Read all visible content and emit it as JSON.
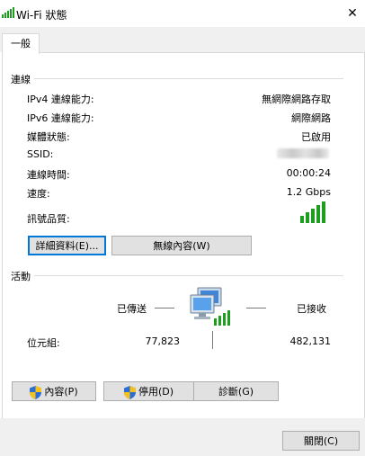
{
  "window": {
    "title": "Wi-Fi 狀態",
    "close_glyph": "✕"
  },
  "tabs": [
    {
      "label": "一般"
    }
  ],
  "connection": {
    "section_label": "連線",
    "rows": [
      {
        "label": "IPv4 連線能力:",
        "value": "無網際網路存取"
      },
      {
        "label": "IPv6 連線能力:",
        "value": "網際網路"
      },
      {
        "label": "媒體狀態:",
        "value": "已啟用"
      },
      {
        "label": "SSID:",
        "value": ""
      },
      {
        "label": "連線時間:",
        "value": "00:00:24"
      },
      {
        "label": "速度:",
        "value": "1.2 Gbps"
      }
    ],
    "signal_label": "訊號品質:",
    "signal_bars": 5,
    "details_button": "詳細資料(E)...",
    "wireless_props_button": "無線內容(W)"
  },
  "activity": {
    "section_label": "活動",
    "sent_label": "已傳送",
    "received_label": "已接收",
    "bytes_label": "位元組:",
    "bytes_sent": "77,823",
    "bytes_received": "482,131"
  },
  "action_buttons": {
    "properties": "內容(P)",
    "disable": "停用(D)",
    "diagnose": "診斷(G)"
  },
  "footer": {
    "close_button": "關閉(C)"
  },
  "colors": {
    "signal_green": "#1e9e1e",
    "accent_blue": "#0078d7",
    "shield_blue": "#2b6fd6",
    "shield_yellow": "#f4c21a"
  },
  "icons": [
    "wifi-signal-icon",
    "close-icon",
    "network-computer-icon",
    "uac-shield-icon"
  ]
}
